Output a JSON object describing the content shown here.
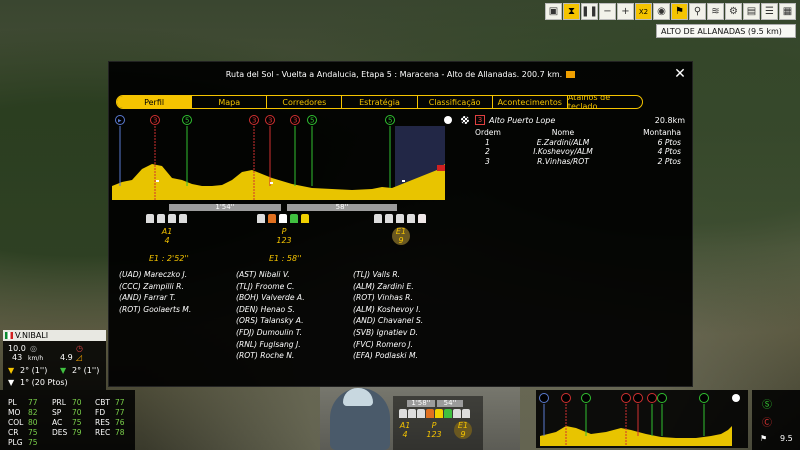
{
  "toolbar": {
    "speed_label": "X2"
  },
  "stage_label": "ALTO DE ALLANADAS (9.5 km)",
  "panel": {
    "title": "Ruta del Sol - Vuelta a Andalucia, Etapa 5 : Maracena - Alto de Allanadas. 200.7 km.",
    "tabs": [
      "Perfil",
      "Mapa",
      "Corredores",
      "Estratégia",
      "Classificação",
      "Acontecimentos",
      "Atalhos de teclado"
    ],
    "active_tab": 0,
    "profile_markers": [
      "3",
      "3",
      "3",
      "3",
      "5",
      "5",
      "5"
    ],
    "gaps": [
      "1'54''",
      "58''"
    ],
    "markers": {
      "a1": {
        "label": "A1",
        "count": "4"
      },
      "p": {
        "label": "P",
        "count": "123"
      },
      "e1": {
        "label": "E1",
        "count": "9"
      }
    },
    "e1_gap_a": "E1 : 2'52''",
    "e1_gap_b": "E1 : 58''",
    "group_a": [
      "(UAD) Mareczko J.",
      "(CCC) Zampilli R.",
      "(AND) Farrar T.",
      "(ROT) Goolaerts M."
    ],
    "group_b": [
      "(AST) Nibali V.",
      "(TLJ) Froome C.",
      "(BOH) Valverde A.",
      "(DEN) Henao S.",
      "(ORS) Talansky A.",
      "(FDJ) Dumoulin T.",
      "(RNL) Fuglsang J.",
      "(ROT) Roche N."
    ],
    "group_c": [
      "(TLJ) Valls R.",
      "(ALM) Zardini E.",
      "(ROT) Vinhas R.",
      "(ALM) Koshevoy I.",
      "(AND) Chavanel S.",
      "(SVB) Ignatiev D.",
      "(FVC) Romero J.",
      "(EFA) Podlaski M."
    ],
    "climb": {
      "cat": "3",
      "name": "Alto Puerto Lope",
      "km": "20.8km"
    },
    "ranking": {
      "headers": [
        "Ordem",
        "Nome",
        "Montanha"
      ],
      "rows": [
        {
          "pos": "1",
          "name": "E.Zardini/ALM",
          "pts": "6 Ptos"
        },
        {
          "pos": "2",
          "name": "I.Koshevoy/ALM",
          "pts": "4 Ptos"
        },
        {
          "pos": "3",
          "name": "R.Vinhas/ROT",
          "pts": "2 Ptos"
        }
      ]
    }
  },
  "rider": {
    "name": "V.NIBALI",
    "speed": "10.0",
    "speed_unit": "km/h",
    "hr": "43",
    "slope": "4.9",
    "gc_yellow": "2° (1'')",
    "gc_green": "2° (1'')",
    "gc_white": "1° (20 Ptos)",
    "stats": [
      {
        "k": "PL",
        "v": "77"
      },
      {
        "k": "PRL",
        "v": "70"
      },
      {
        "k": "CBT",
        "v": "77"
      },
      {
        "k": "MO",
        "v": "82"
      },
      {
        "k": "SP",
        "v": "70"
      },
      {
        "k": "FD",
        "v": "77"
      },
      {
        "k": "COL",
        "v": "80"
      },
      {
        "k": "AC",
        "v": "75"
      },
      {
        "k": "RES",
        "v": "76"
      },
      {
        "k": "CR",
        "v": "75"
      },
      {
        "k": "DES",
        "v": "79"
      },
      {
        "k": "REC",
        "v": "78"
      },
      {
        "k": "PLG",
        "v": "75"
      }
    ]
  },
  "mini": {
    "gaps": [
      "1'58''",
      "54''"
    ],
    "a1": {
      "label": "A1",
      "count": "4"
    },
    "p": {
      "label": "P",
      "count": "123"
    },
    "e1": {
      "label": "E1",
      "count": "9"
    },
    "km_left": "9.5"
  }
}
